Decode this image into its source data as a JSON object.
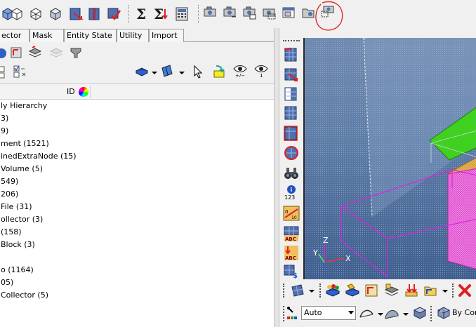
{
  "tabs": [
    {
      "label": "ector"
    },
    {
      "label": "Mask"
    },
    {
      "label": "Entity State"
    },
    {
      "label": "Utility"
    },
    {
      "label": "Import"
    }
  ],
  "tree": {
    "id_header": "ID",
    "rows": [
      "ly Hierarchy",
      "3)",
      "9)",
      "ment (1521)",
      "inedExtraNode (15)",
      "Volume (5)",
      "549)",
      "206)",
      " File (31)",
      "ollector (3)",
      " (158)",
      "Block (3)",
      "",
      "o (1164)",
      "05)",
      "Collector (5)"
    ]
  },
  "bottom": {
    "auto_value": "Auto",
    "by_comp": "By Com"
  },
  "vtools": {
    "id_label": "123"
  },
  "triad": {
    "x": "X",
    "y": "Y",
    "z": "Z"
  },
  "colors": {
    "mesh_magenta": "#e020e0",
    "viewport_top": "#6f8ab0",
    "viewport_bottom": "#3e5e8e",
    "annotation_red": "#e02020",
    "green_part": "#40d020",
    "orange_part": "#d8a040"
  }
}
